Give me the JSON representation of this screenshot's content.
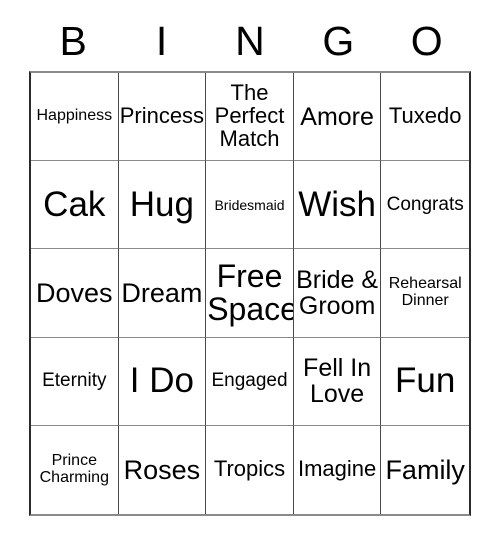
{
  "card": {
    "title": "BINGO",
    "header_letters": [
      "B",
      "I",
      "N",
      "G",
      "O"
    ],
    "free_space_label": "Free Space",
    "grid_size": "5x5",
    "cells": [
      {
        "text": "Happiness",
        "size": "sz-s",
        "free": false
      },
      {
        "text": "Princess",
        "size": "sz-ml",
        "free": false
      },
      {
        "text": "The\nPerfect\nMatch",
        "size": "sz-ml",
        "free": false
      },
      {
        "text": "Amore",
        "size": "sz-l",
        "free": false
      },
      {
        "text": "Tuxedo",
        "size": "sz-ml",
        "free": false
      },
      {
        "text": "Cak",
        "size": "sz-xxxl",
        "free": false
      },
      {
        "text": "Hug",
        "size": "sz-xxxl",
        "free": false
      },
      {
        "text": "Bridesmaid",
        "size": "sz-xs",
        "free": false
      },
      {
        "text": "Wish",
        "size": "sz-xxxl",
        "free": false
      },
      {
        "text": "Congrats",
        "size": "sz-m",
        "free": false
      },
      {
        "text": "Doves",
        "size": "sz-xl",
        "free": false
      },
      {
        "text": "Dream",
        "size": "sz-xl",
        "free": false
      },
      {
        "text": "Free\nSpace",
        "size": "sz-xxl",
        "free": true
      },
      {
        "text": "Bride &\nGroom",
        "size": "sz-l",
        "free": false
      },
      {
        "text": "Rehearsal\nDinner",
        "size": "sz-s",
        "free": false
      },
      {
        "text": "Eternity",
        "size": "sz-m",
        "free": false
      },
      {
        "text": "I Do",
        "size": "sz-xxxl",
        "free": false
      },
      {
        "text": "Engaged",
        "size": "sz-m",
        "free": false
      },
      {
        "text": "Fell In\nLove",
        "size": "sz-l",
        "free": false
      },
      {
        "text": "Fun",
        "size": "sz-xxxl",
        "free": false
      },
      {
        "text": "Prince\nCharming",
        "size": "sz-s",
        "free": false
      },
      {
        "text": "Roses",
        "size": "sz-xl",
        "free": false
      },
      {
        "text": "Tropics",
        "size": "sz-ml",
        "free": false
      },
      {
        "text": "Imagine",
        "size": "sz-ml",
        "free": false
      },
      {
        "text": "Family",
        "size": "sz-xl",
        "free": false
      }
    ]
  },
  "colors": {
    "background": "#ffffff",
    "text": "#000000",
    "grid_line": "#4a4a4a",
    "grid_line_light": "#8a8a8a"
  }
}
